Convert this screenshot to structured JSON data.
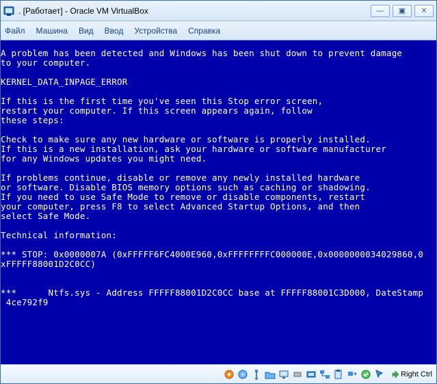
{
  "titlebar": {
    "title": ". [Работает] - Oracle VM VirtualBox"
  },
  "menubar": {
    "items": [
      "Файл",
      "Машина",
      "Вид",
      "Ввод",
      "Устройства",
      "Справка"
    ]
  },
  "bsod": {
    "text": "A problem has been detected and Windows has been shut down to prevent damage\nto your computer.\n\nKERNEL_DATA_INPAGE_ERROR\n\nIf this is the first time you've seen this Stop error screen,\nrestart your computer. If this screen appears again, follow\nthese steps:\n\nCheck to make sure any new hardware or software is properly installed.\nIf this is a new installation, ask your hardware or software manufacturer\nfor any Windows updates you might need.\n\nIf problems continue, disable or remove any newly installed hardware\nor software. Disable BIOS memory options such as caching or shadowing.\nIf you need to use Safe Mode to remove or disable components, restart\nyour computer, press F8 to select Advanced Startup Options, and then\nselect Safe Mode.\n\nTechnical information:\n\n*** STOP: 0x0000007A (0xFFFFF6FC4000E960,0xFFFFFFFFC000000E,0x0000000034029860,0\nxFFFFF88001D2C0CC)\n\n\n***      Ntfs.sys - Address FFFFF88001D2C0CC base at FFFFF88001C3D000, DateStamp\n 4ce792f9"
  },
  "statusbar": {
    "hostkey": "Right Ctrl"
  },
  "icons": {
    "minimize": "—",
    "maximize": "▣",
    "close": "✕"
  }
}
